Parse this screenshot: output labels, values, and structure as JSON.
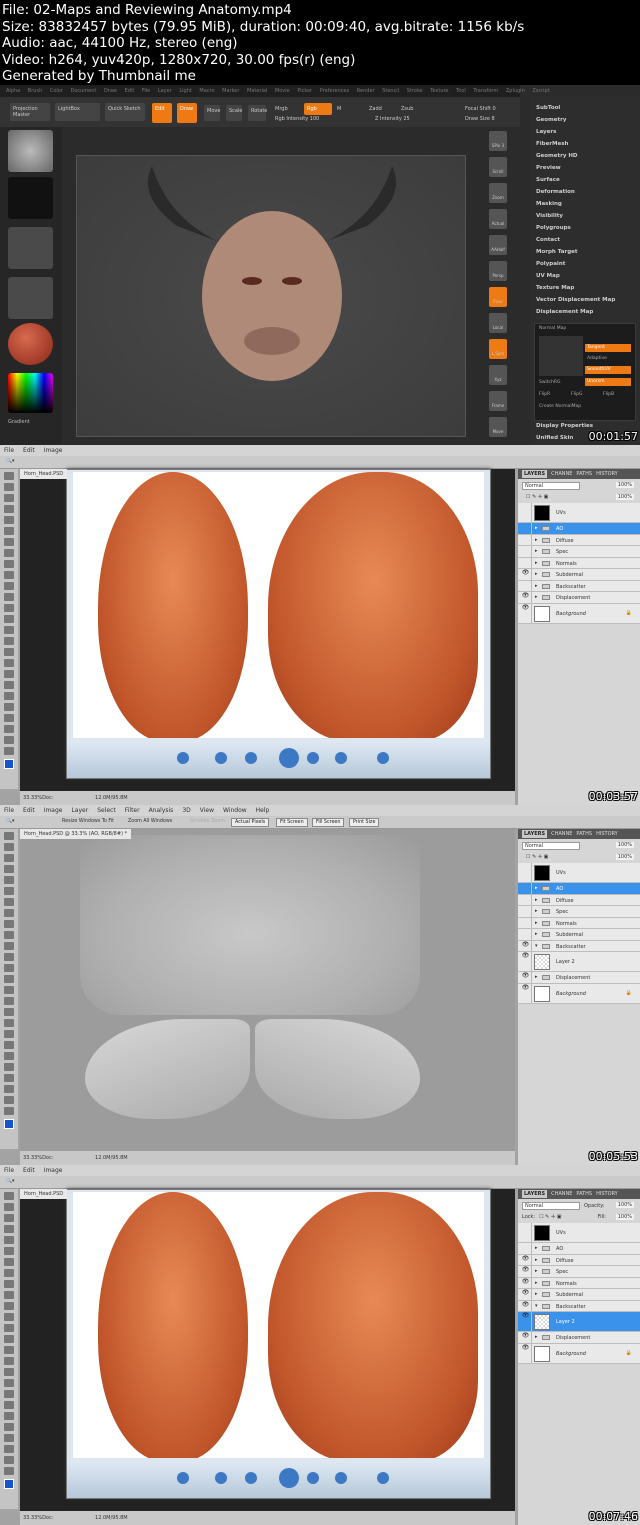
{
  "header": {
    "lines": [
      "File: 02-Maps and Reviewing Anatomy.mp4",
      "Size: 83832457 bytes (79.95 MiB), duration: 00:09:40, avg.bitrate: 1156 kb/s",
      "Audio: aac, 44100 Hz, stereo (eng)",
      "Video: h264, yuv420p, 1280x720, 30.00 fps(r) (eng)",
      "Generated by Thumbnail me"
    ]
  },
  "frames": [
    {
      "timestamp": "00:01:57",
      "app": "ZBrush",
      "menu": "Alpha Brush Color Document Draw Edit File Layer Light Macro Marker Material Movie Picker Preferences Render Stencil Stroke Texture Tool Transform Zplugin Zscript",
      "buttons": {
        "projection_master": "Projection Master",
        "lightbox": "LightBox",
        "quick_sketch": "Quick Sketch",
        "edit": "Edit",
        "draw": "Draw",
        "move": "Move",
        "scale": "Scale",
        "rotate": "Rotate",
        "mrgb": "Mrgb",
        "rgb": "Rgb",
        "m": "M",
        "zadd": "Zadd",
        "zsub": "Zsub",
        "rgb_intensity": "Rgb Intensity 100",
        "z_intensity": "Z Intensity 25",
        "focal_shift": "Focal Shift 0",
        "draw_size": "Draw Size 8"
      },
      "left_labels": {
        "gradient": "Gradient"
      },
      "right_tools": [
        "SPix 3",
        "Scroll",
        "Zoom",
        "Actual",
        "AAHalf",
        "Persp",
        "Floor",
        "Local",
        "L.Sym",
        "Xyz",
        "Frame",
        "Move"
      ],
      "tool_menu": [
        "SubTool",
        "Geometry",
        "Layers",
        "FiberMesh",
        "Geometry HD",
        "Preview",
        "Surface",
        "Deformation",
        "Masking",
        "Visibility",
        "Polygroups",
        "Contact",
        "Morph Target",
        "Polypaint",
        "UV Map",
        "Texture Map",
        "Vector Displacement Map",
        "Displacement Map"
      ],
      "normal_map": {
        "title": "Normal Map",
        "options": [
          "Tangent",
          "Adaptive",
          "SmoothUV",
          "Unorsm"
        ],
        "switch": "SwitchRG",
        "flips": [
          "FlipR",
          "FlipG",
          "FlipB"
        ],
        "create": "Create NormalMap"
      },
      "tool_menu_bottom": [
        "Display Properties",
        "Unified Skin"
      ],
      "accent": "#ee7a14"
    },
    {
      "timestamp": "00:03:57",
      "app": "Photoshop",
      "menu": [
        "File",
        "Edit",
        "Image"
      ],
      "doc_tab": "Horn_Head.PSD",
      "status": {
        "zoom": "33.33%",
        "doc": "Doc: 12.0M/95.8M"
      },
      "layers_panel": {
        "tabs": [
          "LAYERS",
          "CHANNE",
          "PATHS",
          "HISTORY"
        ],
        "blend": "Normal",
        "opacity": "100%",
        "fill": "100%",
        "layers": [
          {
            "name": "UVs",
            "visible": false,
            "type": "thumb-black"
          },
          {
            "name": "AO",
            "visible": false,
            "type": "group",
            "selected": true
          },
          {
            "name": "Diffuse",
            "visible": false,
            "type": "group"
          },
          {
            "name": "Spec",
            "visible": false,
            "type": "group"
          },
          {
            "name": "Normals",
            "visible": false,
            "type": "group"
          },
          {
            "name": "Subdermal",
            "visible": true,
            "type": "group"
          },
          {
            "name": "Backscatter",
            "visible": false,
            "type": "group"
          },
          {
            "name": "Displacement",
            "visible": true,
            "type": "group"
          },
          {
            "name": "Background",
            "visible": true,
            "type": "thumb-white"
          }
        ]
      }
    },
    {
      "timestamp": "00:05:53",
      "app": "Photoshop",
      "menu": [
        "File",
        "Edit",
        "Image",
        "Layer",
        "Select",
        "Filter",
        "Analysis",
        "3D",
        "View",
        "Window",
        "Help"
      ],
      "options": {
        "resize": "Resize Windows To Fit",
        "zoom_all": "Zoom All Windows",
        "scrubby": "Scrubby Zoom",
        "actual": "Actual Pixels",
        "fit": "Fit Screen",
        "fill": "Fill Screen",
        "print": "Print Size"
      },
      "doc_tab": "Horn_Head.PSD @ 33.3% (AO, RGB/8#) *",
      "status": {
        "zoom": "33.33%",
        "doc": "Doc: 12.0M/95.8M"
      },
      "layers_panel": {
        "tabs": [
          "LAYERS",
          "CHANNE",
          "PATHS",
          "HISTORY"
        ],
        "blend": "Normal",
        "opacity": "100%",
        "fill": "100%",
        "layers": [
          {
            "name": "UVs",
            "visible": false,
            "type": "thumb-black"
          },
          {
            "name": "AO",
            "visible": false,
            "type": "group",
            "selected": true
          },
          {
            "name": "Diffuse",
            "visible": false,
            "type": "group"
          },
          {
            "name": "Spec",
            "visible": false,
            "type": "group"
          },
          {
            "name": "Normals",
            "visible": false,
            "type": "group"
          },
          {
            "name": "Subdermal",
            "visible": false,
            "type": "group"
          },
          {
            "name": "Backscatter",
            "visible": true,
            "type": "group-open"
          },
          {
            "name": "Layer 2",
            "visible": true,
            "type": "thumb-trans"
          },
          {
            "name": "Displacement",
            "visible": true,
            "type": "group"
          },
          {
            "name": "Background",
            "visible": true,
            "type": "thumb-white"
          }
        ]
      }
    },
    {
      "timestamp": "00:07:46",
      "app": "Photoshop",
      "menu": [
        "File",
        "Edit",
        "Image"
      ],
      "doc_tab": "Horn_Head.PSD",
      "status": {
        "zoom": "33.33%",
        "doc": "Doc: 12.0M/95.8M"
      },
      "layers_panel": {
        "tabs": [
          "LAYERS",
          "CHANNE",
          "PATHS",
          "HISTORY"
        ],
        "blend": "Normal",
        "opacity_label": "Opacity:",
        "opacity": "100%",
        "lock_label": "Lock:",
        "fill_label": "Fill:",
        "fill": "100%",
        "layers": [
          {
            "name": "UVs",
            "visible": false,
            "type": "thumb-black"
          },
          {
            "name": "AO",
            "visible": false,
            "type": "group"
          },
          {
            "name": "Diffuse",
            "visible": true,
            "type": "group"
          },
          {
            "name": "Spec",
            "visible": true,
            "type": "group"
          },
          {
            "name": "Normals",
            "visible": true,
            "type": "group"
          },
          {
            "name": "Subdermal",
            "visible": true,
            "type": "group"
          },
          {
            "name": "Backscatter",
            "visible": true,
            "type": "group-open"
          },
          {
            "name": "Layer 2",
            "visible": true,
            "type": "thumb-trans",
            "selected": true
          },
          {
            "name": "Displacement",
            "visible": true,
            "type": "group"
          },
          {
            "name": "Background",
            "visible": true,
            "type": "thumb-white"
          }
        ]
      }
    }
  ]
}
